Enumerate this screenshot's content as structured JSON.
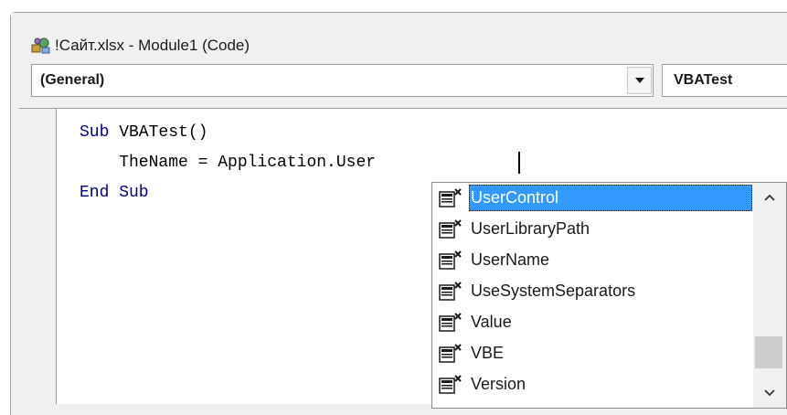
{
  "window": {
    "title": "!Сайт.xlsx - Module1 (Code)",
    "icon": "vba-module-icon"
  },
  "toolbar": {
    "object_combo_value": "(General)",
    "procedure_combo_value": "VBATest"
  },
  "code": {
    "line1_kw": "Sub",
    "line1_rest": " VBATest()",
    "line2": "    TheName = Application.User",
    "line3_kw": "End Sub"
  },
  "autocomplete": {
    "items": [
      {
        "label": "UserControl",
        "icon": "property-icon",
        "selected": true
      },
      {
        "label": "UserLibraryPath",
        "icon": "property-icon"
      },
      {
        "label": "UserName",
        "icon": "property-icon"
      },
      {
        "label": "UseSystemSeparators",
        "icon": "property-icon"
      },
      {
        "label": "Value",
        "icon": "property-icon"
      },
      {
        "label": "VBE",
        "icon": "property-icon"
      },
      {
        "label": "Version",
        "icon": "property-icon"
      }
    ],
    "selected_color": "#3399ff"
  }
}
